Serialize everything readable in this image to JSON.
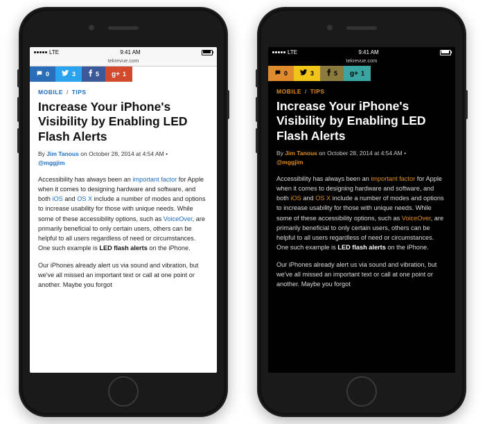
{
  "status": {
    "carrier": "LTE",
    "time": "9:41 AM",
    "url": "tekrevue.com"
  },
  "share": {
    "comment_count": "0",
    "twitter_count": "3",
    "fb_count": "5",
    "gplus_count": "1"
  },
  "crumb": {
    "a": "MOBILE",
    "b": "TIPS"
  },
  "article": {
    "title": "Increase Your iPhone's Visibility by Enabling LED Flash Alerts",
    "by_prefix": "By ",
    "author": "Jim Tanous",
    "date_text": " on October 28, 2014 at 4:54 AM • ",
    "handle": "@mggjim",
    "p1_a": "Accessibility has always been an ",
    "p1_link1": "important factor",
    "p1_b": " for Apple when it comes to designing hardware and software, and both ",
    "p1_link2": "iOS",
    "p1_c": " and ",
    "p1_link3": "OS X",
    "p1_d": " include a number of modes and options to increase usability for those with unique needs. While some of these accessibility options, such as ",
    "p1_link4": "VoiceOver",
    "p1_e": ", are primarily beneficial to only certain users, others can be helpful to all users regardless of need or circumstances. One such example is ",
    "p1_bold": "LED flash alerts",
    "p1_f": " on the iPhone.",
    "p2": "Our iPhones already alert us via sound and vibration, but we've all missed an important text or call at one point or another. Maybe you forgot"
  }
}
